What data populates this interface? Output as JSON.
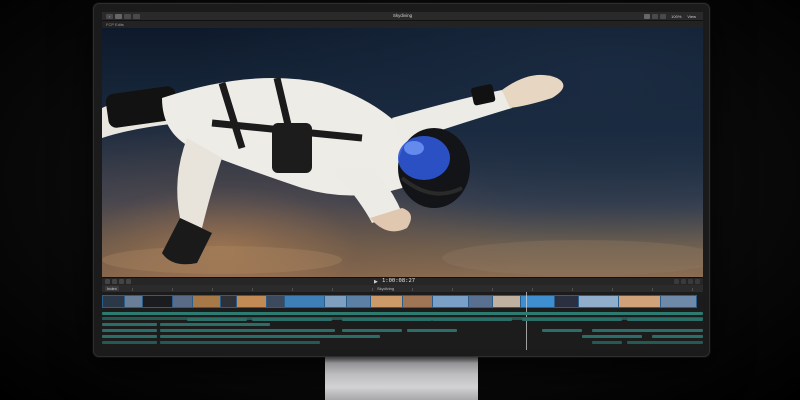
{
  "app": {
    "library_name": "FCP Edits",
    "window_title": "Skydiving",
    "zoom_level": "100%",
    "view_menu": "View"
  },
  "timeline": {
    "timecode": "1:00:08:27",
    "index_label": "Index",
    "project_name": "Skydiving"
  },
  "colors": {
    "audio_lane": "#2a6e67",
    "audio_lane_dark": "#245a54",
    "primary_clip_border": "#2b5d8a",
    "toolbar": "#2a2a2b"
  },
  "icons": [
    "back-icon",
    "grid-icon",
    "layout-icon",
    "play-icon",
    "blade-icon",
    "zoom-icon",
    "settings-icon"
  ]
}
